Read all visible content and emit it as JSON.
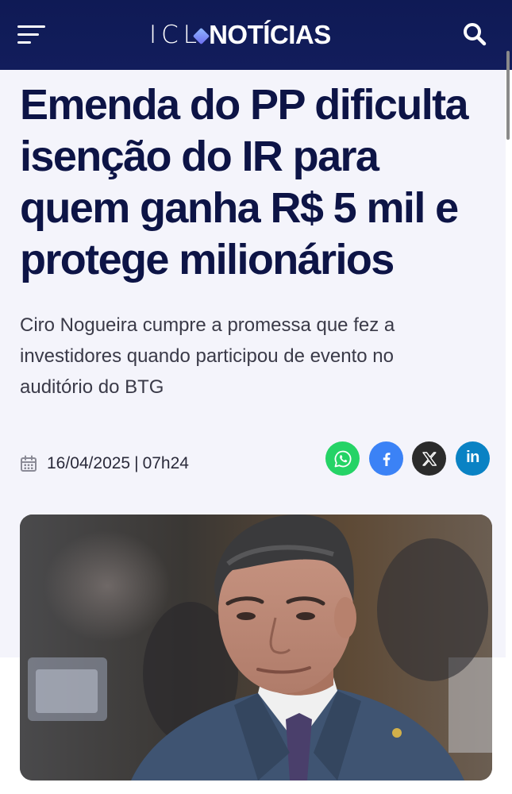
{
  "header": {
    "logo_brand": "ICL",
    "logo_section": "NOTÍCIAS",
    "menu_icon": "hamburger-menu-icon",
    "search_icon": "search-icon",
    "background_color": "#121d5c"
  },
  "article": {
    "headline": "Emenda do PP dificulta isenção do IR para quem ganha R$ 5 mil e protege milionários",
    "subtitle": "Ciro Nogueira cumpre a promessa que fez a investidores quando participou de evento no auditório do BTG",
    "date": "16/04/2025",
    "time": "07h24",
    "date_icon": "calendar-icon",
    "image_icon": "article-photo"
  },
  "share": [
    {
      "network": "whatsapp",
      "icon": "whatsapp-icon",
      "color": "#25d366"
    },
    {
      "network": "facebook",
      "icon": "facebook-icon",
      "color": "#3b82f6"
    },
    {
      "network": "x",
      "icon": "x-icon",
      "color": "#2b2b2b"
    },
    {
      "network": "linkedin",
      "icon": "linkedin-icon",
      "label": "in",
      "color": "#0a82c4"
    }
  ],
  "colors": {
    "headline": "#0d1446",
    "page_background": "#f4f4fb"
  }
}
